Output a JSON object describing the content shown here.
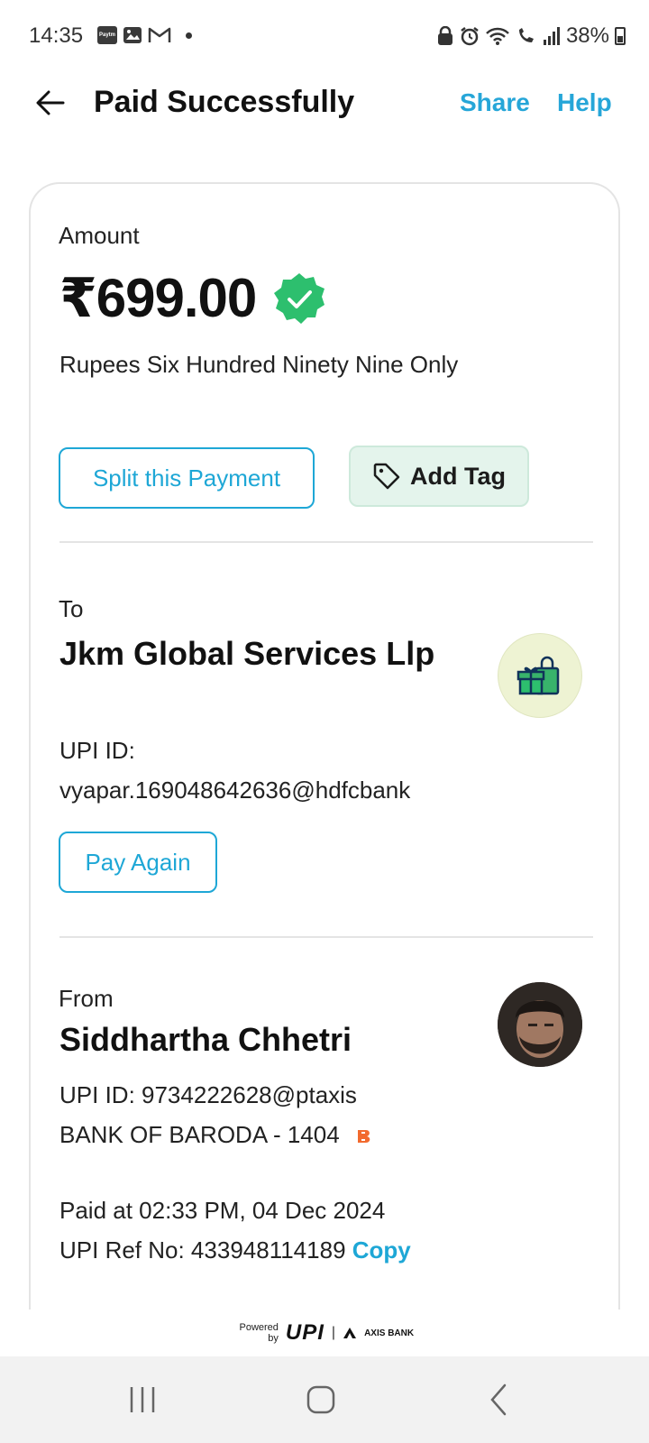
{
  "status_bar": {
    "time": "14:35",
    "battery": "38%",
    "left_icons": [
      "paytm-icon",
      "gallery-icon",
      "gmail-icon",
      "dot-icon"
    ],
    "right_icons": [
      "lock-icon",
      "alarm-icon",
      "wifi-icon",
      "call-icon",
      "signal-icon",
      "battery-icon"
    ],
    "paytm_mini_label": "Paytm"
  },
  "header": {
    "title": "Paid Successfully",
    "share_label": "Share",
    "help_label": "Help"
  },
  "amount_section": {
    "label": "Amount",
    "value": "₹699.00",
    "words": "Rupees Six Hundred Ninety Nine Only",
    "split_label": "Split this Payment",
    "tag_label": "Add Tag"
  },
  "to_section": {
    "label": "To",
    "name": "Jkm Global Services Llp",
    "upi_label": "UPI ID:",
    "upi_id": "vyapar.169048642636@hdfcbank",
    "pay_again_label": "Pay Again"
  },
  "from_section": {
    "label": "From",
    "name": "Siddhartha Chhetri",
    "upi_line": "UPI ID: 9734222628@ptaxis",
    "bank_line": "BANK OF BARODA - 1404",
    "paid_at": "Paid at 02:33 PM, 04 Dec 2024",
    "ref_line": "UPI Ref No: 433948114189",
    "copy_label": "Copy"
  },
  "footer": {
    "powered_by": "Powered by",
    "upi": "UPI",
    "bank": "AXIS BANK"
  },
  "colors": {
    "accent": "#1ea7d6",
    "verified_green": "#2dbf6e",
    "tag_bg": "#e4f4ec"
  }
}
